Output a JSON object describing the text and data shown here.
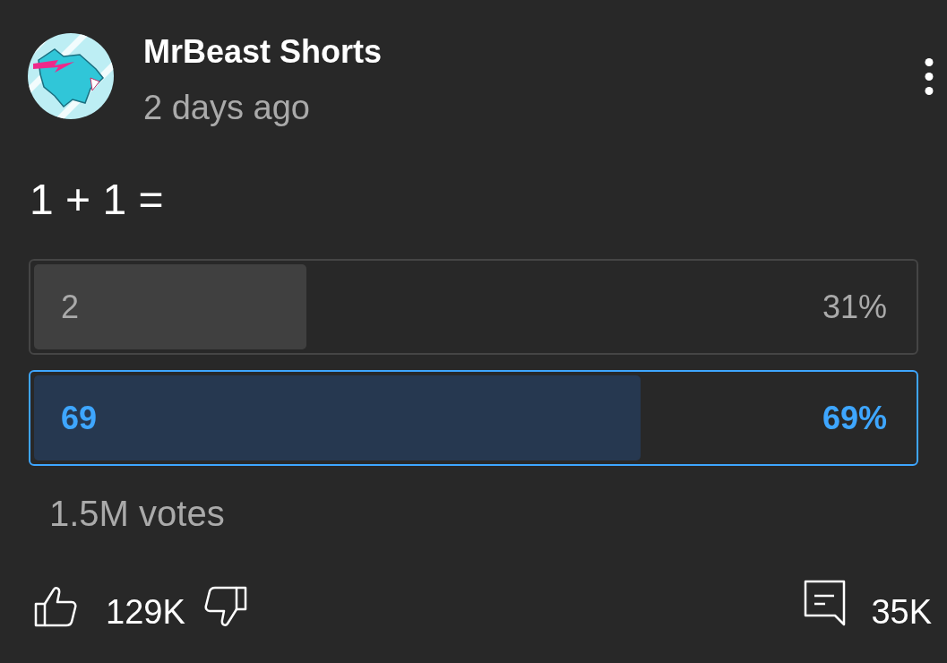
{
  "post": {
    "channel": "MrBeast Shorts",
    "time": "2 days ago"
  },
  "question": "1 + 1 =",
  "poll": {
    "options": [
      {
        "label": "2",
        "percent": "31%",
        "level": 0.31,
        "selected": false
      },
      {
        "label": "69",
        "percent": "69%",
        "level": 0.69,
        "selected": true
      }
    ],
    "votes": "1.5M votes"
  },
  "actions": {
    "likes": "129K",
    "comments": "35K"
  }
}
